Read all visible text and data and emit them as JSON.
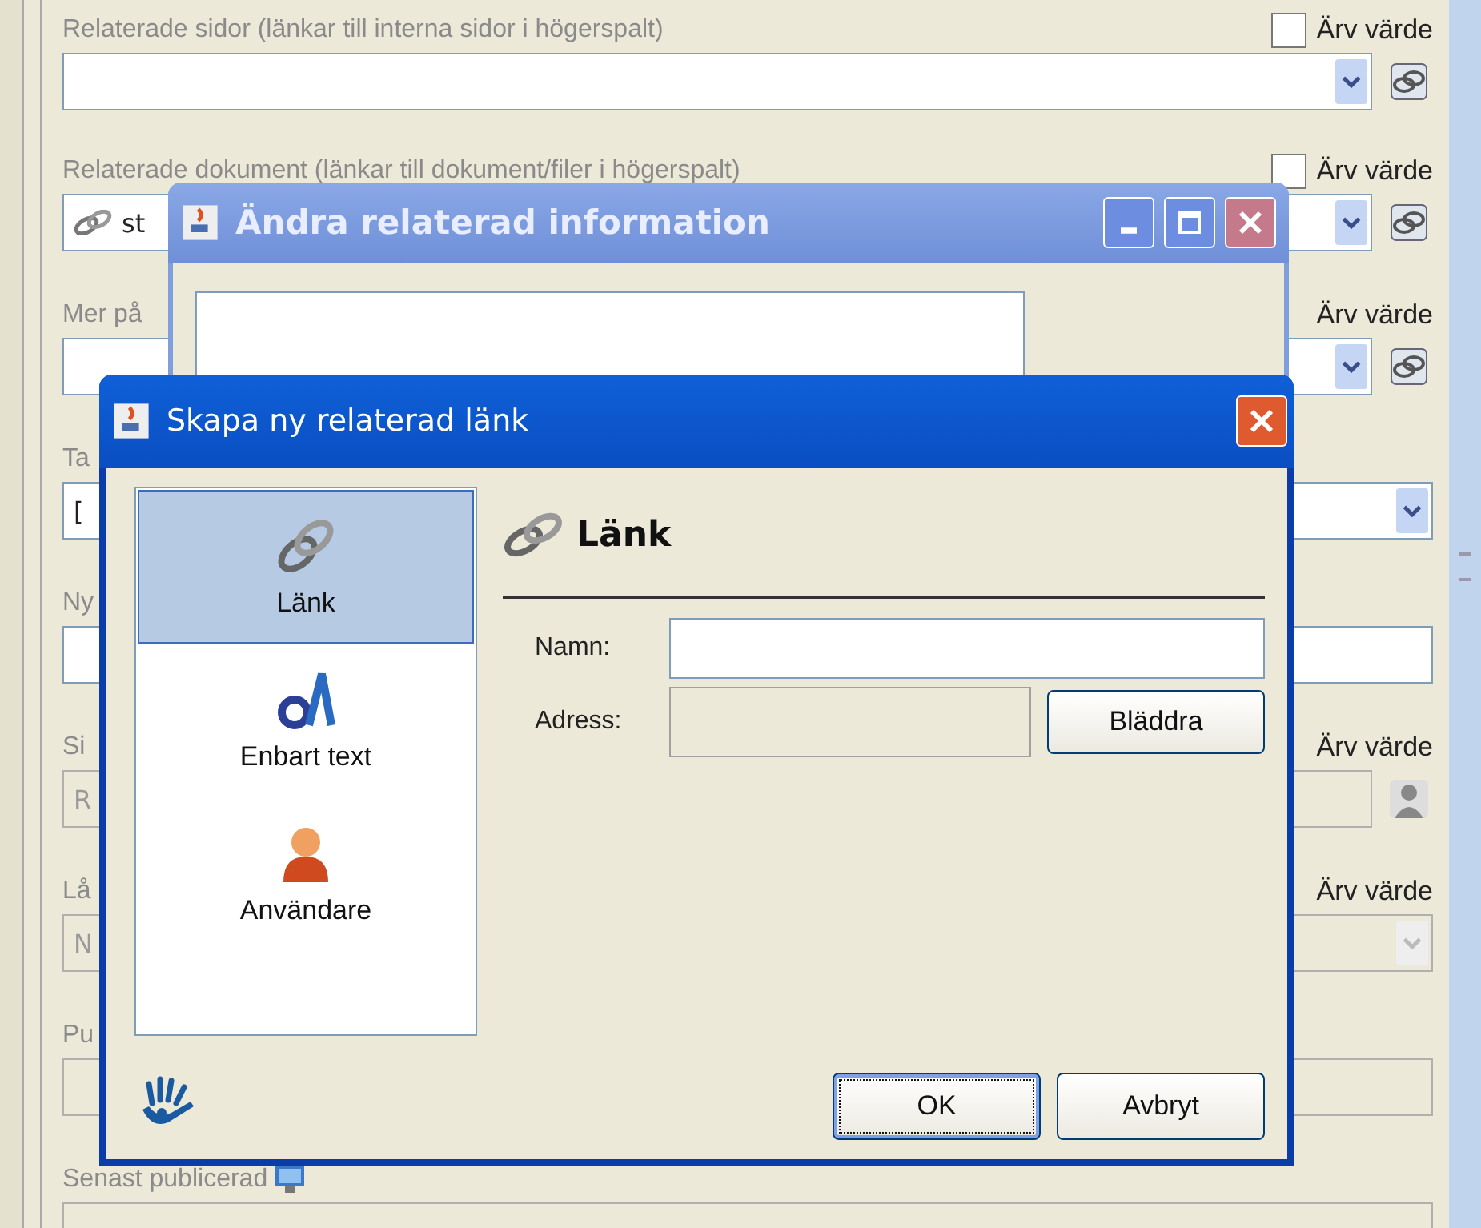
{
  "background_form": {
    "fields": [
      {
        "label": "Relaterade sidor (länkar till interna sidor i högerspalt)",
        "kind": "linkcombo",
        "inherit": {
          "label": "Ärv värde",
          "checked": false
        }
      },
      {
        "label": "Relaterade dokument (länkar till dokument/filer i högerspalt)",
        "kind": "linkcombo",
        "value": "st",
        "inherit": {
          "label": "Ärv värde",
          "checked": false
        }
      },
      {
        "label": "Mer på",
        "kind": "linkcombo",
        "inherit": {
          "label": "Ärv värde"
        }
      },
      {
        "label": "Ta",
        "kind": "combo",
        "value": "["
      },
      {
        "label": "Ny",
        "kind": "text"
      },
      {
        "label": "Si",
        "kind": "usertext",
        "value": "R",
        "disabled": true,
        "inherit": {
          "label": "Ärv värde"
        }
      },
      {
        "label": "Lå",
        "kind": "combo",
        "value": "N",
        "disabled": true,
        "inherit": {
          "label": "Ärv värde"
        }
      },
      {
        "label": "Pu",
        "kind": "text",
        "disabled": true
      },
      {
        "label": "Senast publicerad",
        "kind": "published",
        "disabled": true
      }
    ]
  },
  "back_dialog": {
    "title": "Ändra relaterad information"
  },
  "dialog": {
    "title": "Skapa ny relaterad länk",
    "types": [
      {
        "label": "Länk",
        "kind": "link",
        "selected": true
      },
      {
        "label": "Enbart text",
        "kind": "text",
        "selected": false
      },
      {
        "label": "Användare",
        "kind": "user",
        "selected": false
      }
    ],
    "heading": "Länk",
    "fields": [
      {
        "label": "Namn:",
        "disabled": false
      },
      {
        "label": "Adress:",
        "disabled": true,
        "button": "Bläddra"
      }
    ],
    "buttons": [
      {
        "label": "OK",
        "default": true
      },
      {
        "label": "Avbryt",
        "default": false
      }
    ]
  }
}
